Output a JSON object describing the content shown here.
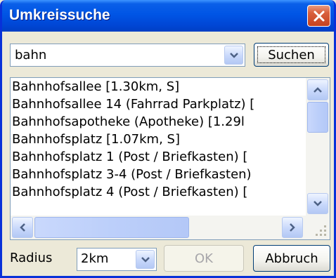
{
  "window": {
    "title": "Umkreissuche"
  },
  "search": {
    "value": "bahn",
    "button_label": "Suchen"
  },
  "results": {
    "items": [
      "Bahnhofsallee [1.30km, S]",
      "Bahnhofsallee 14 (Fahrrad Parkplatz) [",
      "Bahnhofsapotheke (Apotheke) [1.29l",
      "Bahnhofsplatz [1.07km, S]",
      "Bahnhofsplatz 1 (Post / Briefkasten) [",
      "Bahnhofsplatz 3-4 (Post / Briefkasten)",
      "Bahnhofsplatz 4 (Post / Briefkasten) ["
    ],
    "vertical_scroll_position": 0.0,
    "horizontal_scroll_position": 0.0
  },
  "footer": {
    "radius_label": "Radius",
    "radius_value": "2km",
    "ok_label": "OK",
    "cancel_label": "Abbruch"
  },
  "colors": {
    "titlebar": "#0055e5",
    "close_button": "#c5421f",
    "disabled_text": "#a7a6aa",
    "dialog_background": "#ece9d8"
  },
  "icons": {
    "close": "close-icon",
    "dropdown": "chevron-down-icon",
    "scroll_up": "arrow-up-icon",
    "scroll_down": "arrow-down-icon",
    "scroll_left": "arrow-left-icon",
    "scroll_right": "arrow-right-icon",
    "size_grip": "size-grip-icon"
  }
}
